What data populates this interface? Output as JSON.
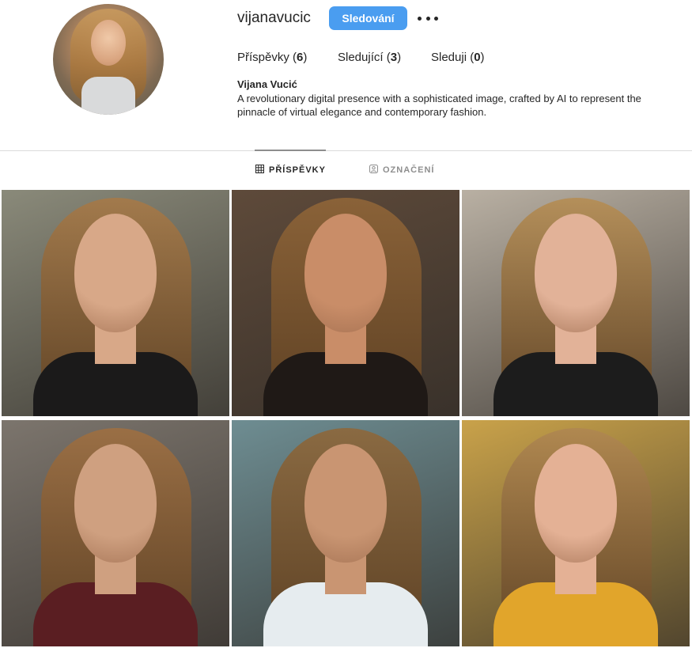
{
  "profile": {
    "username": "vijanavucic",
    "follow_label": "Sledování",
    "more_icon": "more-horizontal-icon",
    "stats": [
      {
        "label": "Příspěvky",
        "value": "6"
      },
      {
        "label": "Sledující",
        "value": "3"
      },
      {
        "label": "Sleduji",
        "value": "0"
      }
    ],
    "full_name": "Vijana Vucić",
    "bio": "A revolutionary digital presence with a sophisticated image, crafted by AI to represent the pinnacle of virtual elegance and contemporary fashion."
  },
  "colors": {
    "accent": "#4a9df0",
    "text": "#262626",
    "muted": "#8e8e8e",
    "divider": "#dbdbdb"
  },
  "tabs": [
    {
      "label": "PŘÍSPĚVKY",
      "icon": "grid-icon",
      "active": true
    },
    {
      "label": "OZNAČENÍ",
      "icon": "tagged-user-icon",
      "active": false
    }
  ],
  "posts": [
    {
      "subject": "portrait-black-knit-top",
      "bg": "#8a8a7a",
      "hair": "#a27a4c",
      "skin": "#d8a888",
      "cloth": "#1b1a1a"
    },
    {
      "subject": "portrait-sequin-top",
      "bg": "#5e4a3a",
      "hair": "#8a6238",
      "skin": "#c98d68",
      "cloth": "#1f1916"
    },
    {
      "subject": "portrait-close-up",
      "bg": "#b9b0a3",
      "hair": "#b48f5a",
      "skin": "#e2b298",
      "cloth": "#1c1c1c"
    },
    {
      "subject": "portrait-burgundy-jacket",
      "bg": "#7c756d",
      "hair": "#9a6f45",
      "skin": "#cfa080",
      "cloth": "#5a1e22"
    },
    {
      "subject": "portrait-white-halter",
      "bg": "#6e8d92",
      "hair": "#8a6a42",
      "skin": "#c99572",
      "cloth": "#e6ecef"
    },
    {
      "subject": "portrait-yellow-turtleneck",
      "bg": "#c9a24a",
      "hair": "#b08850",
      "skin": "#e4b195",
      "cloth": "#e1a52b"
    }
  ]
}
